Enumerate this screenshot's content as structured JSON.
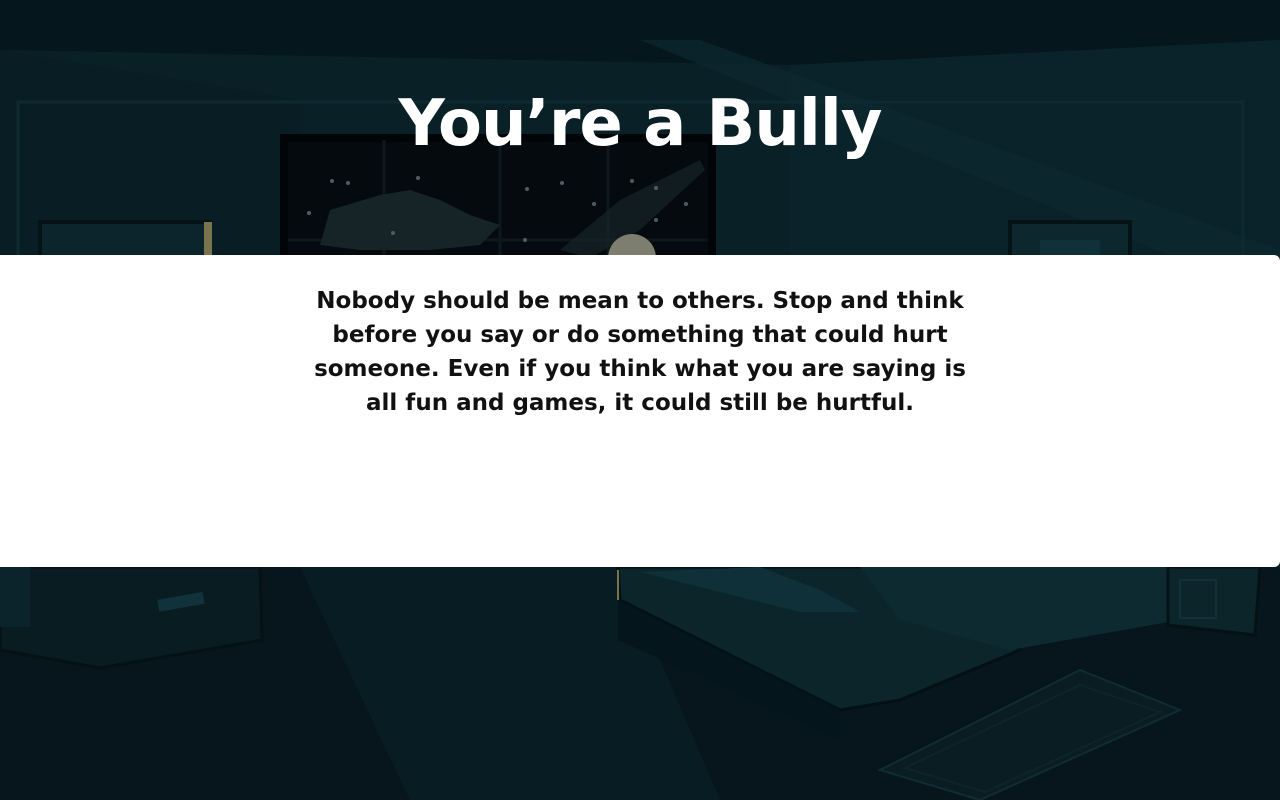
{
  "screen": {
    "title": "You’re a Bully",
    "message": "Nobody should be mean to others. Stop and think before you say or do something that could hurt someone. Even if you think what you are saying is all fun and games, it could still be hurtful."
  },
  "background": {
    "scene": "dark-bedroom-at-night",
    "colors": {
      "base": "#071a22",
      "wall": "#0d2b33",
      "accent": "#123a42",
      "window_sky": "#0a0f12",
      "moon": "#8f8f80"
    }
  }
}
